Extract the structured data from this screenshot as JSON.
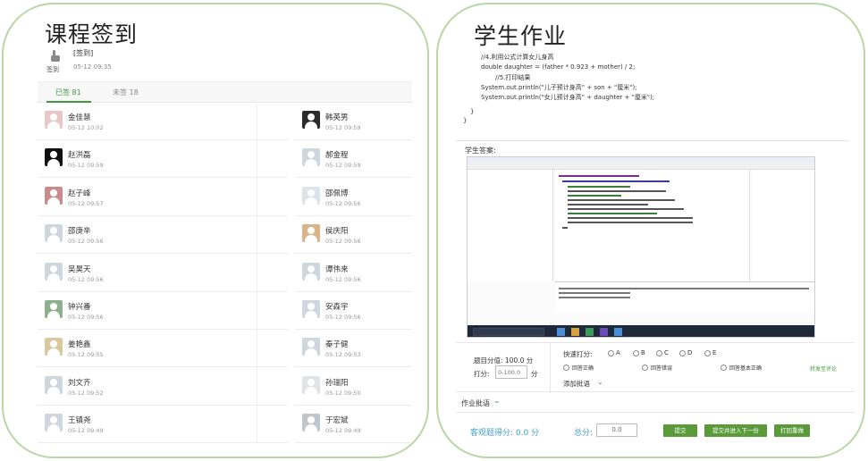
{
  "left": {
    "title": "课程签到",
    "sign": {
      "icon_label": "签到",
      "title": "[签到]",
      "time": "05-12 09:35"
    },
    "tabs": [
      {
        "label": "已签 81",
        "active": true
      },
      {
        "label": "未签 18",
        "active": false
      }
    ],
    "students": [
      {
        "name": "金佳慧",
        "time": "05-12 10:02"
      },
      {
        "name": "韩英男",
        "time": "05-12 09:59"
      },
      {
        "name": "赵洪磊",
        "time": "05-12 09:59"
      },
      {
        "name": "郝金程",
        "time": "05-12 09:59"
      },
      {
        "name": "赵子峰",
        "time": "05-12 09:57"
      },
      {
        "name": "邵佩博",
        "time": "05-12 09:56"
      },
      {
        "name": "邵庚辛",
        "time": "05-12 09:56"
      },
      {
        "name": "侯庆阳",
        "time": "05-12 09:56"
      },
      {
        "name": "吴昊天",
        "time": "05-12 09:56"
      },
      {
        "name": "谭伟来",
        "time": "05-12 09:56"
      },
      {
        "name": "钟兴番",
        "time": "05-12 09:56"
      },
      {
        "name": "安森宇",
        "time": "05-12 09:56"
      },
      {
        "name": "姜艳鑫",
        "time": "05-12 09:55"
      },
      {
        "name": "秦子健",
        "time": "05-12 09:53"
      },
      {
        "name": "刘文齐",
        "time": "05-12 09:52"
      },
      {
        "name": "孙瑞阳",
        "time": "05-12 09:50"
      },
      {
        "name": "王镇尧",
        "time": "05-12 09:49"
      },
      {
        "name": "于宏斌",
        "time": "05-12 09:49"
      }
    ]
  },
  "right": {
    "title": "学生作业",
    "code": [
      "//4.利用公式计算女儿身高",
      "double daughter = (father * 0.923 + mother) / 2;",
      "//5.打印结果",
      "System.out.println(\"儿子预计身高\" + son + \"厘米\");",
      "System.out.println(\"女儿预计身高\" + daughter + \"厘米\");",
      "}",
      "}"
    ],
    "answer_label": "学生答案:",
    "grading": {
      "full_score": "题目分值: 100.0 分",
      "give_score_label": "打分:",
      "score_placeholder": "0-100.0",
      "score_unit": "分",
      "quick_label": "快速打分:",
      "options": [
        "A",
        "B",
        "C",
        "D",
        "E"
      ],
      "verdicts": [
        "回答正确",
        "回答错误",
        "回答基本正确"
      ],
      "add_comment": "添加批语",
      "forward_comment": "转发至评论"
    },
    "homework_comment": "作业批语",
    "bottom": {
      "objective_score": "客观题得分: 0.0 分",
      "total_label": "总分:",
      "total_value": "0.0",
      "buttons": [
        "提交",
        "提交并进入下一份",
        "打回重做"
      ]
    }
  },
  "colors": {
    "accent": "#3f9a3f",
    "button": "#5a9a3a",
    "blue_text": "#46a0c4",
    "panel_border": "#b9d6a4"
  }
}
